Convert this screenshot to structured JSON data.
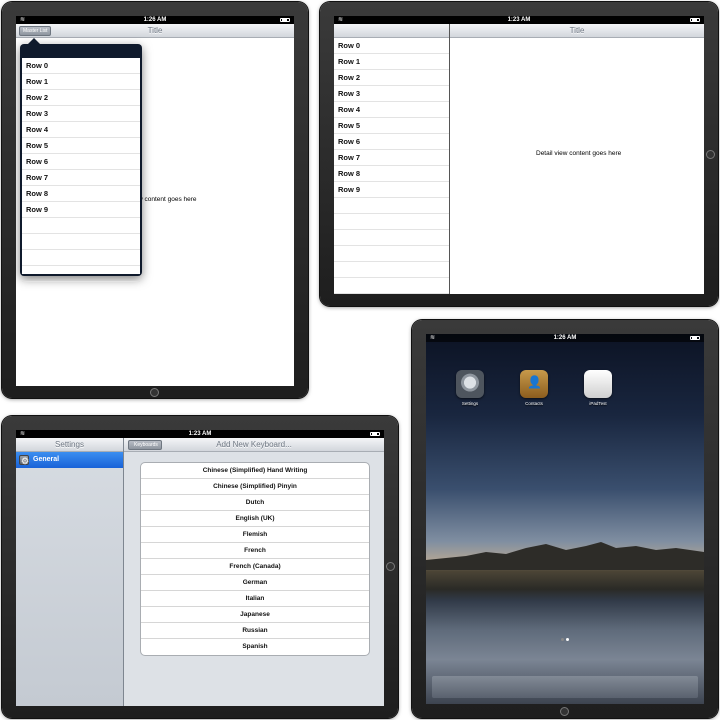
{
  "panel_popover": {
    "status_time": "1:26 AM",
    "nav_title": "Title",
    "master_button": "Master List",
    "rows": [
      "Row 0",
      "Row 1",
      "Row 2",
      "Row 3",
      "Row 4",
      "Row 5",
      "Row 6",
      "Row 7",
      "Row 8",
      "Row 9"
    ],
    "detail_partial": "w content goes here"
  },
  "panel_split": {
    "status_time": "1:23 AM",
    "nav_title": "Title",
    "rows": [
      "Row 0",
      "Row 1",
      "Row 2",
      "Row 3",
      "Row 4",
      "Row 5",
      "Row 6",
      "Row 7",
      "Row 8",
      "Row 9"
    ],
    "detail_text": "Detail view content goes here"
  },
  "panel_settings": {
    "status_time": "1:23 AM",
    "sidebar_title": "Settings",
    "sidebar_item": "General",
    "back_button": "Keyboards",
    "nav_title": "Add New Keyboard...",
    "keyboards": [
      "Chinese (Simplified) Hand Writing",
      "Chinese (Simplified) Pinyin",
      "Dutch",
      "English (UK)",
      "Flemish",
      "French",
      "French (Canada)",
      "German",
      "Italian",
      "Japanese",
      "Russian",
      "Spanish"
    ]
  },
  "panel_home": {
    "status_time": "1:26 AM",
    "apps": [
      {
        "label": "Settings",
        "icon": "settings-icon"
      },
      {
        "label": "Contacts",
        "icon": "contacts-icon"
      },
      {
        "label": "iPadTest",
        "icon": "app-icon"
      }
    ],
    "page_dots": 2,
    "active_dot": 1
  },
  "colors": {
    "selection_blue": "#1962d8",
    "nav_gradient_top": "#f4f5f7",
    "nav_gradient_bottom": "#d2d6dc",
    "bezel": "#1e1e1e"
  }
}
